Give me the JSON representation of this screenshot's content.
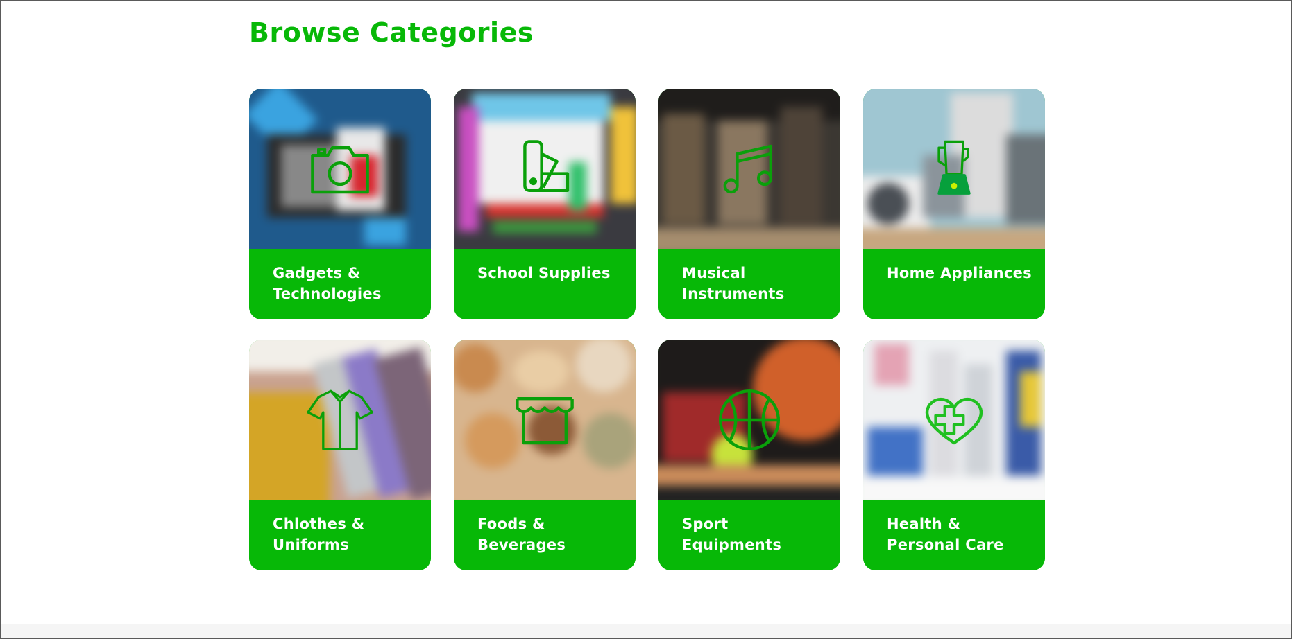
{
  "page": {
    "title": "Browse Categories"
  },
  "theme": {
    "accent": "#07b807",
    "icon_color": "#0aa00a",
    "label_text": "#ffffff"
  },
  "categories": [
    {
      "label": "Gadgets & Technologies",
      "icon": "camera-icon"
    },
    {
      "label": "School Supplies",
      "icon": "swatch-book-icon"
    },
    {
      "label": "Musical Instruments",
      "icon": "music-note-icon"
    },
    {
      "label": "Home Appliances",
      "icon": "blender-icon"
    },
    {
      "label": "Chlothes & Uniforms",
      "icon": "shirt-icon"
    },
    {
      "label": "Foods & Beverages",
      "icon": "storefront-icon"
    },
    {
      "label": "Sport Equipments",
      "icon": "basketball-icon"
    },
    {
      "label": "Health & Personal Care",
      "icon": "health-heart-icon"
    }
  ]
}
